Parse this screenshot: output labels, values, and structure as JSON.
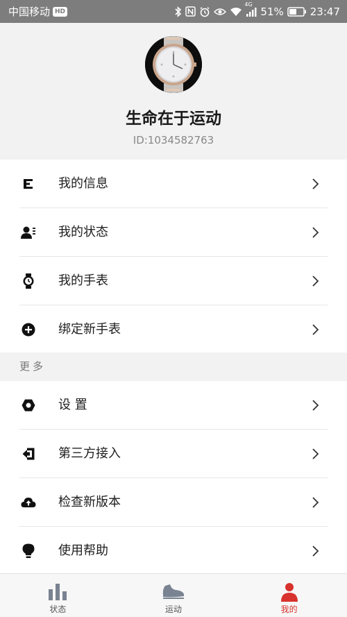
{
  "status_bar": {
    "carrier": "中国移动",
    "hd": "HD",
    "network": "4G",
    "battery": "51%",
    "time": "23:47"
  },
  "profile": {
    "name": "生命在于运动",
    "id": "ID:1034582763"
  },
  "menu": [
    {
      "label": "我的信息",
      "icon": "list-icon"
    },
    {
      "label": "我的状态",
      "icon": "user-status-icon"
    },
    {
      "label": "我的手表",
      "icon": "watch-icon"
    },
    {
      "label": "绑定新手表",
      "icon": "add-circle-icon"
    }
  ],
  "more": {
    "header": "更多",
    "items": [
      {
        "label": "设 置",
        "icon": "settings-icon"
      },
      {
        "label": "第三方接入",
        "icon": "import-icon"
      },
      {
        "label": "检查新版本",
        "icon": "cloud-icon"
      },
      {
        "label": "使用帮助",
        "icon": "lightbulb-icon"
      }
    ]
  },
  "bottom_nav": [
    {
      "label": "状态",
      "icon": "bar-chart-icon",
      "active": false
    },
    {
      "label": "运动",
      "icon": "shoe-icon",
      "active": false
    },
    {
      "label": "我的",
      "icon": "person-icon",
      "active": true
    }
  ],
  "colors": {
    "status_bar_bg": "#7d7d7d",
    "active_accent": "#d8322e",
    "background": "#f2f2f2"
  }
}
